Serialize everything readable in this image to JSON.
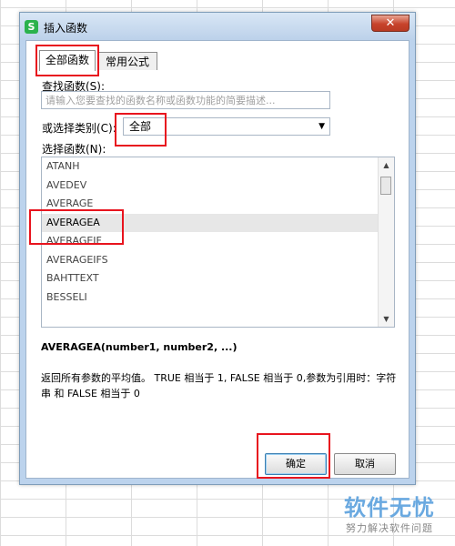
{
  "dialog": {
    "title": "插入函数",
    "app_icon_glyph": "S",
    "close_glyph": "✕"
  },
  "tabs": [
    {
      "label": "全部函数",
      "active": true
    },
    {
      "label": "常用公式",
      "active": false
    }
  ],
  "search": {
    "label": "查找函数(S):",
    "placeholder": "请输入您要查找的函数名称或函数功能的简要描述..."
  },
  "category": {
    "label": "或选择类别(C):",
    "selected": "全部",
    "caret": "▼"
  },
  "function_list": {
    "label": "选择函数(N):",
    "items": [
      "ATANH",
      "AVEDEV",
      "AVERAGE",
      "AVERAGEA",
      "AVERAGEIF",
      "AVERAGEIFS",
      "BAHTTEXT",
      "BESSELI"
    ],
    "selected": "AVERAGEA",
    "scroll_up": "▲",
    "scroll_down": "▼"
  },
  "details": {
    "signature": "AVERAGEA(number1, number2, ...)",
    "description": "返回所有参数的平均值。 TRUE 相当于 1, FALSE 相当于 0,参数为引用时：字符串 和 FALSE 相当于 0"
  },
  "buttons": {
    "ok": "确定",
    "cancel": "取消"
  },
  "watermark": {
    "main": "软件无忧",
    "sub": "努力解决软件问题"
  },
  "colors": {
    "highlight": "#e8141e",
    "title_bar": "#bcd3ed",
    "close_button": "#c7432b",
    "watermark": "#6aa9e0"
  }
}
